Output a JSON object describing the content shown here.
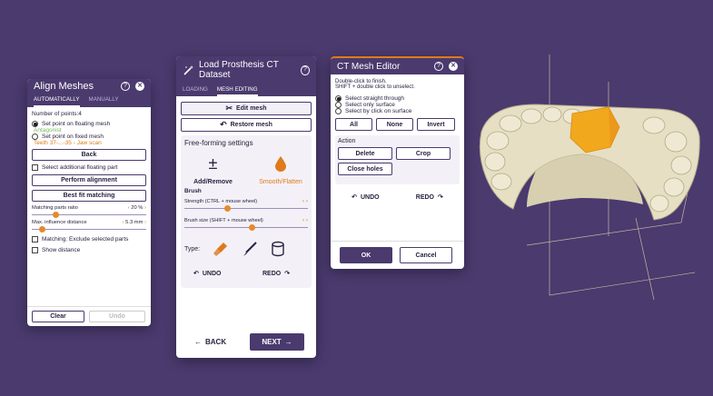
{
  "align": {
    "title": "Align Meshes",
    "tabs": [
      "AUTOMATICALLY",
      "MANUALLY"
    ],
    "points_label": "Number of points:4",
    "float_radio": "Set point on floating mesh",
    "float_value": "Antagonist",
    "fixed_radio": "Set point on fixed mesh",
    "fixed_value": "Teeth 37-...-35 - Jaw scan",
    "back": "Back",
    "additional": "Select additional floating part",
    "perform": "Perform alignment",
    "bestfit": "Best fit matching",
    "ratio_label": "Matching parts ratio",
    "ratio_value": "20 %",
    "ratio_level": 0.2,
    "distance_label": "Max. influence distance",
    "distance_value": "5.3 mm",
    "distance_level": 0.08,
    "exclude": "Matching: Exclude selected parts",
    "show_distance": "Show distance",
    "clear": "Clear",
    "undo": "Undo"
  },
  "prosthesis": {
    "title": "Load Prosthesis CT Dataset",
    "tabs": [
      "LOADING",
      "MESH EDITING"
    ],
    "edit_mesh": "Edit mesh",
    "restore_mesh": "Restore mesh",
    "freeform": "Free-forming settings",
    "add_remove": "Add/Remove",
    "smooth": "Smooth/Flatten",
    "brush": "Brush",
    "strength": "Strength (CTRL + mouse wheel)",
    "strength_level": 0.35,
    "size": "Brush size (SHIFT + mouse wheel)",
    "size_level": 0.55,
    "type": "Type:",
    "undo": "UNDO",
    "redo": "REDO",
    "back": "BACK",
    "next": "NEXT"
  },
  "ct": {
    "title": "CT Mesh Editor",
    "hint1": "Double-click to finish.",
    "hint2": "SHIFT + double click to unselect.",
    "opt1": "Select straight through",
    "opt2": "Select only surface",
    "opt3": "Select by click on surface",
    "all": "All",
    "none": "None",
    "invert": "Invert",
    "action": "Action",
    "delete": "Delete",
    "crop": "Crop",
    "close_holes": "Close holes",
    "undo": "UNDO",
    "redo": "REDO",
    "ok": "OK",
    "cancel": "Cancel"
  },
  "colors": {
    "background": "#4a3a6e",
    "accent": "#e07a1b",
    "highlight": "#f2a81d"
  }
}
